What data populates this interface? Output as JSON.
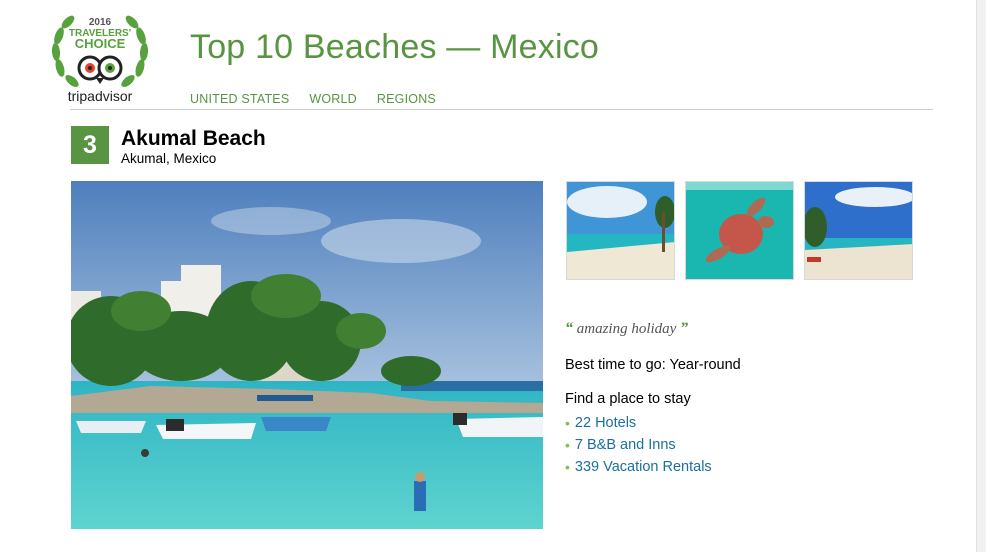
{
  "logo": {
    "year": "2016",
    "award_line1": "TRAVELERS'",
    "award_line2": "CHOICE",
    "brand": "tripadvisor"
  },
  "header": {
    "title": "Top 10 Beaches — Mexico",
    "nav": [
      "UNITED STATES",
      "WORLD",
      "REGIONS"
    ]
  },
  "listing": {
    "rank": "3",
    "name": "Akumal Beach",
    "location": "Akumal, Mexico",
    "quote": "amazing holiday",
    "quote_open": "“",
    "quote_close": "”",
    "best_time": "Best time to go: Year-round",
    "find_title": "Find a place to stay",
    "stay_links": [
      "22 Hotels",
      "7 B&B and Inns",
      "339 Vacation Rentals"
    ]
  },
  "colors": {
    "brand_green": "#589442",
    "link_blue": "#1a6fa0",
    "bullet_green": "#8cbf3f"
  },
  "icons": {
    "logo": "tripadvisor-owl-laurel-logo",
    "bullet": "bullet-dot"
  }
}
